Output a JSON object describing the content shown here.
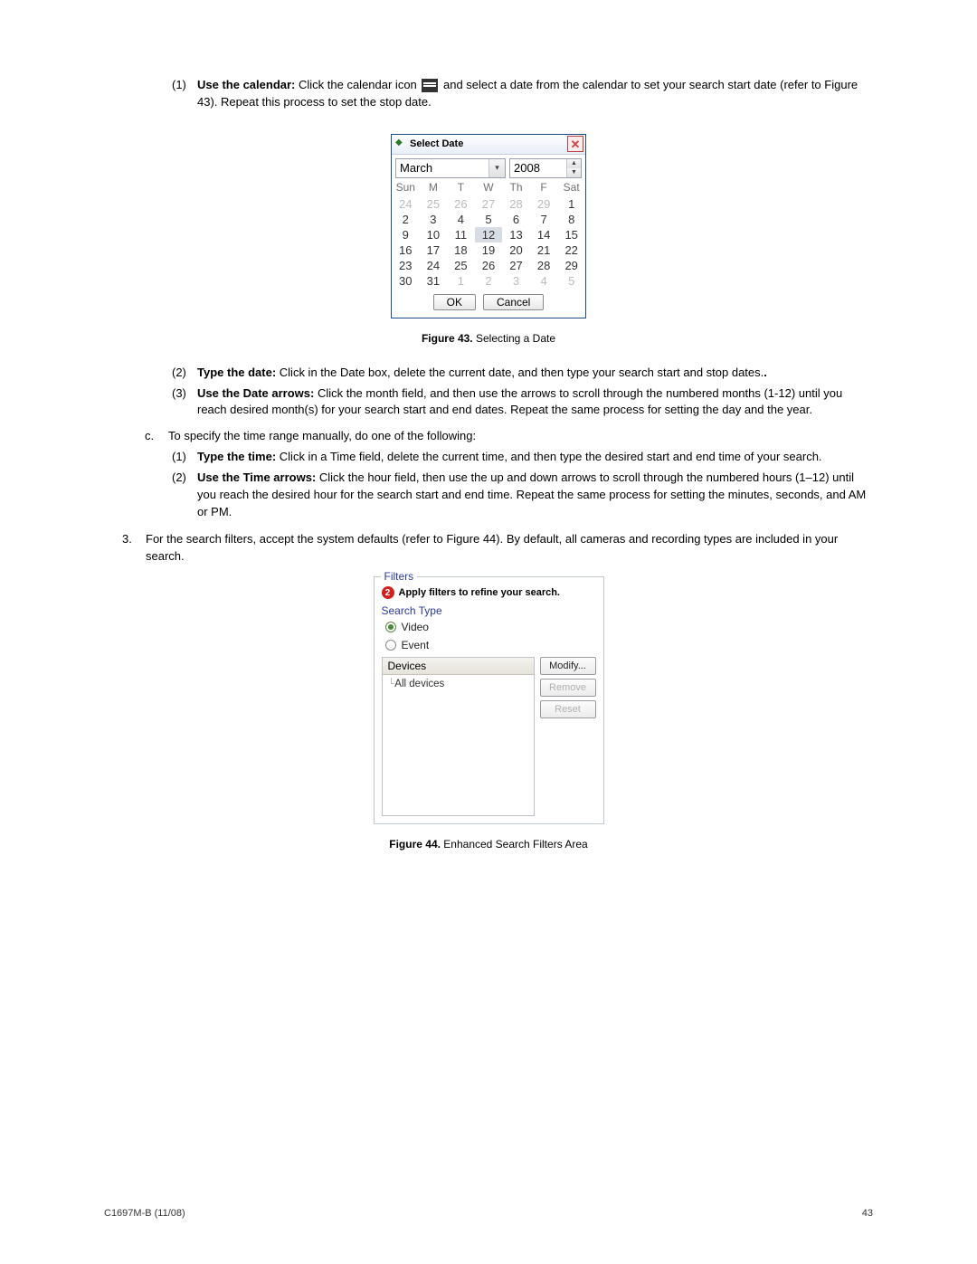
{
  "step1": {
    "num": "(1)",
    "bold": "Use the calendar:",
    "text_a": " Click the calendar icon ",
    "text_b": " and select a date from the calendar to set your search start date (refer to Figure 43). Repeat this process to set the stop date."
  },
  "calendar": {
    "title": "Select Date",
    "month": "March",
    "year": "2008",
    "days": [
      "Sun",
      "M",
      "T",
      "W",
      "Th",
      "F",
      "Sat"
    ],
    "rows": [
      [
        {
          "v": "24",
          "d": true
        },
        {
          "v": "25",
          "d": true
        },
        {
          "v": "26",
          "d": true
        },
        {
          "v": "27",
          "d": true
        },
        {
          "v": "28",
          "d": true
        },
        {
          "v": "29",
          "d": true
        },
        {
          "v": "1"
        }
      ],
      [
        {
          "v": "2"
        },
        {
          "v": "3"
        },
        {
          "v": "4"
        },
        {
          "v": "5"
        },
        {
          "v": "6"
        },
        {
          "v": "7"
        },
        {
          "v": "8"
        }
      ],
      [
        {
          "v": "9"
        },
        {
          "v": "10"
        },
        {
          "v": "11"
        },
        {
          "v": "12",
          "s": true
        },
        {
          "v": "13"
        },
        {
          "v": "14"
        },
        {
          "v": "15"
        }
      ],
      [
        {
          "v": "16"
        },
        {
          "v": "17"
        },
        {
          "v": "18"
        },
        {
          "v": "19"
        },
        {
          "v": "20"
        },
        {
          "v": "21"
        },
        {
          "v": "22"
        }
      ],
      [
        {
          "v": "23"
        },
        {
          "v": "24"
        },
        {
          "v": "25"
        },
        {
          "v": "26"
        },
        {
          "v": "27"
        },
        {
          "v": "28"
        },
        {
          "v": "29"
        }
      ],
      [
        {
          "v": "30"
        },
        {
          "v": "31"
        },
        {
          "v": "1",
          "d": true
        },
        {
          "v": "2",
          "d": true
        },
        {
          "v": "3",
          "d": true
        },
        {
          "v": "4",
          "d": true
        },
        {
          "v": "5",
          "d": true
        }
      ]
    ],
    "ok": "OK",
    "cancel": "Cancel"
  },
  "fig43": {
    "label": "Figure 43.",
    "caption": "  Selecting a Date"
  },
  "step2": {
    "num": "(2)",
    "bold": "Type the date:",
    "text": " Click in the Date box, delete the current date, and then type your search start and stop dates."
  },
  "step3": {
    "num": "(3)",
    "bold": "Use the Date arrows:",
    "text": " Click the month field, and then use the arrows to scroll through the numbered months (1-12) until you reach desired month(s) for your search start and end dates. Repeat the same process for setting the day and the year."
  },
  "stepC": {
    "num": "c.",
    "text": "To specify the time range manually, do one of the following:"
  },
  "stepC1": {
    "num": "(1)",
    "bold": "Type the time:",
    "text": " Click in a Time field, delete the current time, and then type the desired start and end time of your search."
  },
  "stepC2": {
    "num": "(2)",
    "bold": "Use the Time arrows:",
    "text": " Click the hour field, then use the up and down arrows to scroll through the numbered hours (1–12) until you reach the desired hour for the search start and end time. Repeat the same process for setting the minutes, seconds, and AM or PM."
  },
  "step3main": {
    "num": "3.",
    "text": "For the search filters, accept the system defaults (refer to Figure 44). By default, all cameras and recording types are included in your search."
  },
  "filters": {
    "legend": "Filters",
    "step": "2",
    "instr": "Apply filters to refine your search.",
    "search_type_label": "Search Type",
    "video": "Video",
    "event": "Event",
    "devices_header": "Devices",
    "tree_item": "All devices",
    "modify": "Modify...",
    "remove": "Remove",
    "reset": "Reset"
  },
  "fig44": {
    "label": "Figure 44.",
    "caption": "  Enhanced Search Filters Area"
  },
  "footer": {
    "left": "C1697M-B (11/08)",
    "right": "43"
  }
}
